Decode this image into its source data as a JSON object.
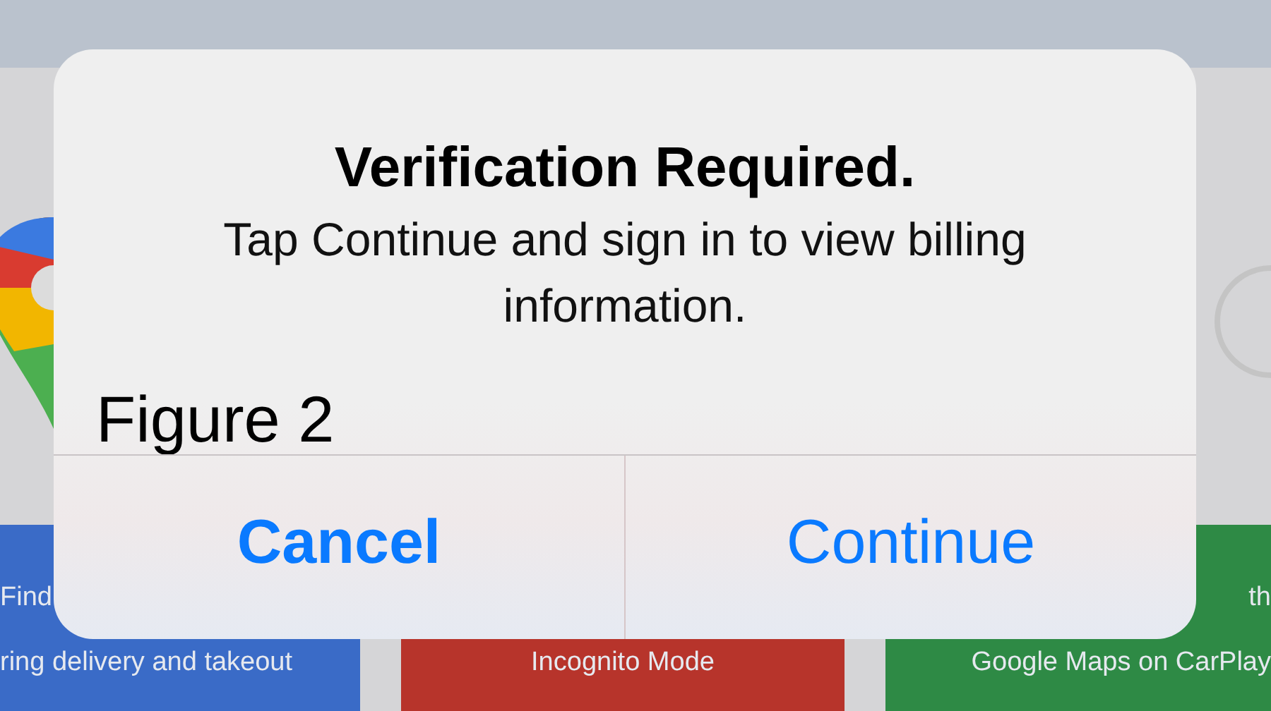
{
  "background": {
    "cards": [
      {
        "color": "#3a6bc7",
        "lines": [
          "Find",
          "ring delivery and takeout"
        ]
      },
      {
        "color": "#b7342b",
        "lines": [
          "Incognito Mode"
        ]
      },
      {
        "color": "#2e8a45",
        "lines": [
          "th",
          "Google Maps on CarPlay"
        ]
      }
    ]
  },
  "alert": {
    "title": "Verification Required.",
    "message": "Tap Continue and sign in to view billing information.",
    "buttons": [
      {
        "label": "Cancel",
        "kind": "cancel"
      },
      {
        "label": "Continue",
        "kind": "default"
      }
    ]
  },
  "figure_label": "Figure 2"
}
